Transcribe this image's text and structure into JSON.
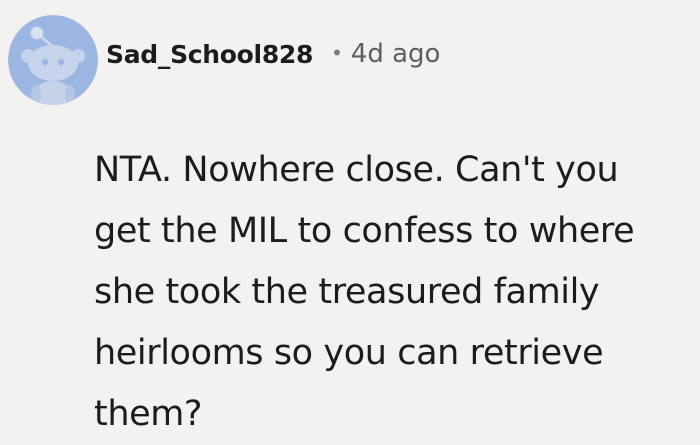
{
  "comment": {
    "author": {
      "username": "Sad_School828",
      "avatar_icon": "reddit-snoo-avatar-icon",
      "avatar_color": "#9cb6e4"
    },
    "separator": "•",
    "timestamp": "4d ago",
    "body_lines": [
      "NTA. Nowhere close. Can't you",
      "get the MIL to confess to where",
      "she took the treasured family",
      "heirlooms so you can retrieve",
      "them?"
    ]
  },
  "colors": {
    "background": "#f3f2f1",
    "text": "#1c1c1c",
    "muted": "#5e5e5e"
  }
}
